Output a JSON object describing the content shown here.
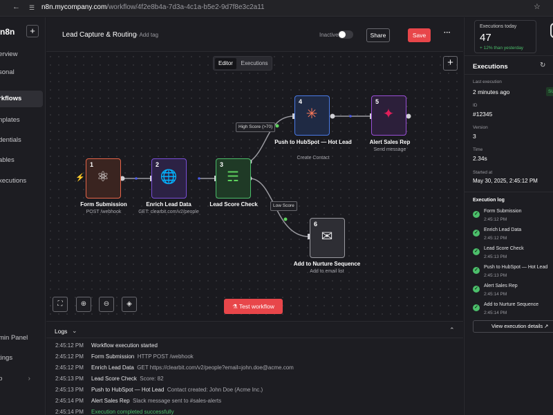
{
  "browser": {
    "url_host": "n8n.mycompany.com",
    "url_path": "/workflow/4f2e8b4a-7d3a-4c1a-b5e2-9d7f8e3c2a11"
  },
  "sidebar": {
    "logo": "n8n",
    "items": [
      {
        "label": "Overview",
        "shown": "erview"
      },
      {
        "label": "Personal",
        "shown": "sonal"
      },
      {
        "label": "Workflows",
        "shown": "rkflows"
      },
      {
        "label": "Templates",
        "shown": "nplates"
      },
      {
        "label": "Credentials",
        "shown": "dentials"
      },
      {
        "label": "Variables",
        "shown": "ables"
      },
      {
        "label": "Executions",
        "shown": "xecutions"
      },
      {
        "label": "Admin Panel",
        "shown": "min Panel"
      },
      {
        "label": "Settings",
        "shown": "tings"
      },
      {
        "label": "Help",
        "shown": "p"
      }
    ]
  },
  "header": {
    "title": "Lead Capture & Routing",
    "add_tag": "+ Add tag",
    "status": "Inactive",
    "share": "Share",
    "save": "Save",
    "more": "···"
  },
  "canvas": {
    "tabs": [
      "Editor",
      "Executions"
    ],
    "nodes": [
      {
        "num": "1",
        "name": "Form Submission",
        "sub": "POST /webhook",
        "icon": "webhook-icon",
        "color": "#e8664a"
      },
      {
        "num": "2",
        "name": "Enrich Lead Data",
        "sub": "GET: clearbit.com/v2/people",
        "icon": "globe-icon",
        "color": "#7b4fd8"
      },
      {
        "num": "3",
        "name": "Lead Score Check",
        "sub": "",
        "icon": "switch-icon",
        "color": "#4cbf6b"
      },
      {
        "num": "4",
        "name": "Push to HubSpot — Hot Lead",
        "sub": "Create Contact",
        "icon": "hubspot-icon",
        "color": "#4a7be8"
      },
      {
        "num": "5",
        "name": "Alert Sales Rep",
        "sub": "Send message",
        "icon": "slack-icon",
        "color": "#9b4fd8"
      },
      {
        "num": "6",
        "name": "Add to Nurture Sequence",
        "sub": "Add to email list",
        "icon": "mail-icon",
        "color": "#9a9aa0"
      }
    ],
    "edge_labels": {
      "high": "High Score (>70)",
      "low": "Low Score"
    },
    "test_button": "Test workflow"
  },
  "logs": {
    "title": "Logs",
    "rows": [
      {
        "time": "2:45:12 PM",
        "name": "Workflow execution started",
        "msg": ""
      },
      {
        "time": "2:45:12 PM",
        "name": "Form Submission",
        "msg": "HTTP POST /webhook"
      },
      {
        "time": "2:45:12 PM",
        "name": "Enrich Lead Data",
        "msg": "GET https://clearbit.com/v2/people?email=john.doe@acme.com"
      },
      {
        "time": "2:45:13 PM",
        "name": "Lead Score Check",
        "msg": "Score: 82"
      },
      {
        "time": "2:45:13 PM",
        "name": "Push to HubSpot — Hot Lead",
        "msg": "Contact created: John Doe (Acme Inc.)"
      },
      {
        "time": "2:45:14 PM",
        "name": "Alert Sales Rep",
        "msg": "Slack message sent to #sales-alerts"
      },
      {
        "time": "2:45:14 PM",
        "name": "Execution completed successfully",
        "msg": ""
      }
    ]
  },
  "right_panel": {
    "stat": {
      "label": "Executions today",
      "value": "47",
      "delta": "+ 12% than yesterday"
    },
    "title": "Executions",
    "last_execution_label": "Last execution",
    "last_execution": "2 minutes ago",
    "status_badge": "SU",
    "id_label": "ID",
    "id": "#12345",
    "version_label": "Version",
    "version": "3",
    "time_label": "Time",
    "time": "2.34s",
    "started_label": "Started at",
    "started": "May 30, 2025, 2:45:12 PM",
    "log_title": "Execution log",
    "steps": [
      {
        "name": "Form Submission",
        "time": "2:45:12 PM"
      },
      {
        "name": "Enrich Lead Data",
        "time": "2:45:12 PM"
      },
      {
        "name": "Lead Score Check",
        "time": "2:45:13 PM"
      },
      {
        "name": "Push to HubSpot — Hot Lead",
        "time": "2:45:13 PM"
      },
      {
        "name": "Alert Sales Rep",
        "time": "2:45:14 PM"
      },
      {
        "name": "Add to Nurture Sequence",
        "time": "2:45:14 PM"
      }
    ],
    "details_button": "View execution details"
  }
}
